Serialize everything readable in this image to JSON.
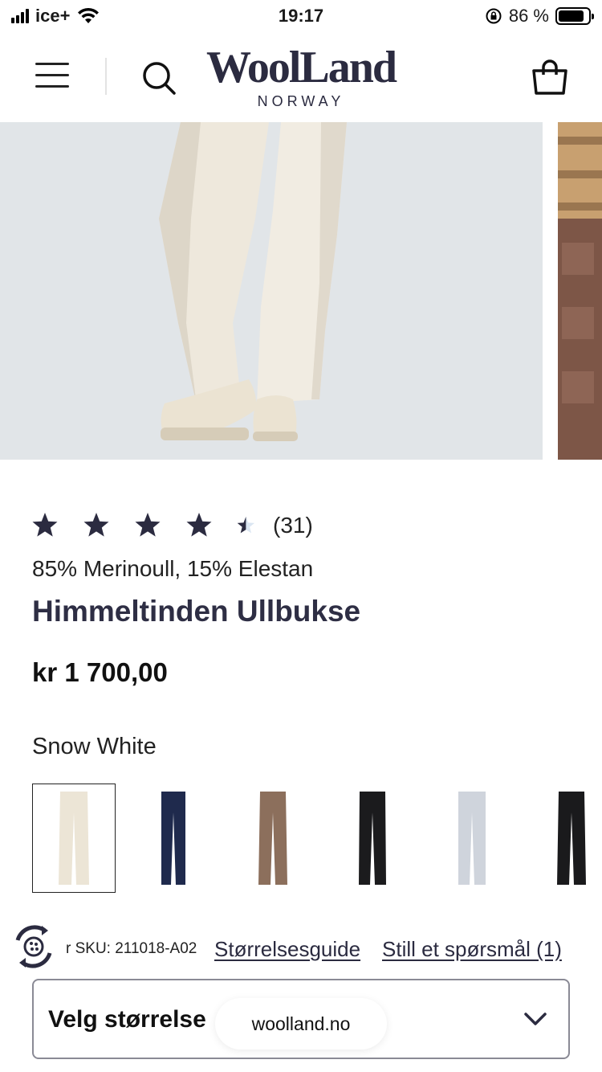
{
  "status_bar": {
    "carrier": "ice+",
    "time": "19:17",
    "battery_percent": "86 %",
    "battery_level": 0.86
  },
  "header": {
    "logo_main": "WoolLand",
    "logo_sub": "NORWAY",
    "icons": [
      "menu-icon",
      "search-icon",
      "shopping-bag-icon"
    ]
  },
  "product": {
    "rating_value": 4.5,
    "rating_count": "(31)",
    "material": "85% Merinoull, 15% Elestan",
    "title": "Himmeltinden Ullbukse",
    "price": "kr 1 700,00",
    "color_name": "Snow White",
    "swatches": [
      {
        "color": "#ece5d6",
        "selected": true
      },
      {
        "color": "#1f2a4d",
        "selected": false
      },
      {
        "color": "#8c6f5c",
        "selected": false
      },
      {
        "color": "#1b1b1d",
        "selected": false
      },
      {
        "color": "#cfd4dc",
        "selected": false
      },
      {
        "color": "#1a1a1c",
        "selected": false
      }
    ]
  },
  "links": {
    "sku": "r SKU: 211018-A02",
    "size_guide": "Størrelsesguide",
    "ask_question": "Still et spørsmål (1)"
  },
  "size_select": {
    "label": "Velg størrelse"
  },
  "url_pill": "woolland.no",
  "colors": {
    "brand_navy": "#2e2e44",
    "hero_bg": "#e1e5e8",
    "star": "#2b2b40"
  }
}
